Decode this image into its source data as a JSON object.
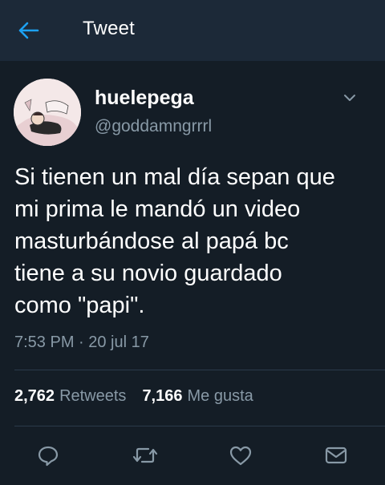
{
  "header": {
    "title": "Tweet",
    "back_icon": "arrow-left-icon"
  },
  "tweet": {
    "author": {
      "display_name": "huelepega",
      "handle": "@goddamngrrrl"
    },
    "text": "Si tienen un mal día sepan que\nmi prima le mandó un video\nmasturbándose al papá bc\ntiene a su novio guardado\ncomo \"papi\".",
    "timestamp": "7:53 PM · 20 jul 17",
    "retweets": {
      "count": "2,762",
      "label": "Retweets"
    },
    "likes": {
      "count": "7,166",
      "label": "Me gusta"
    }
  },
  "actions": [
    "reply-icon",
    "retweet-icon",
    "like-icon",
    "direct-message-icon"
  ],
  "colors": {
    "background": "#141d26",
    "header": "#1c2938",
    "accent": "#1da1f2",
    "secondary_text": "#8899a6",
    "icon": "#8899a6"
  }
}
